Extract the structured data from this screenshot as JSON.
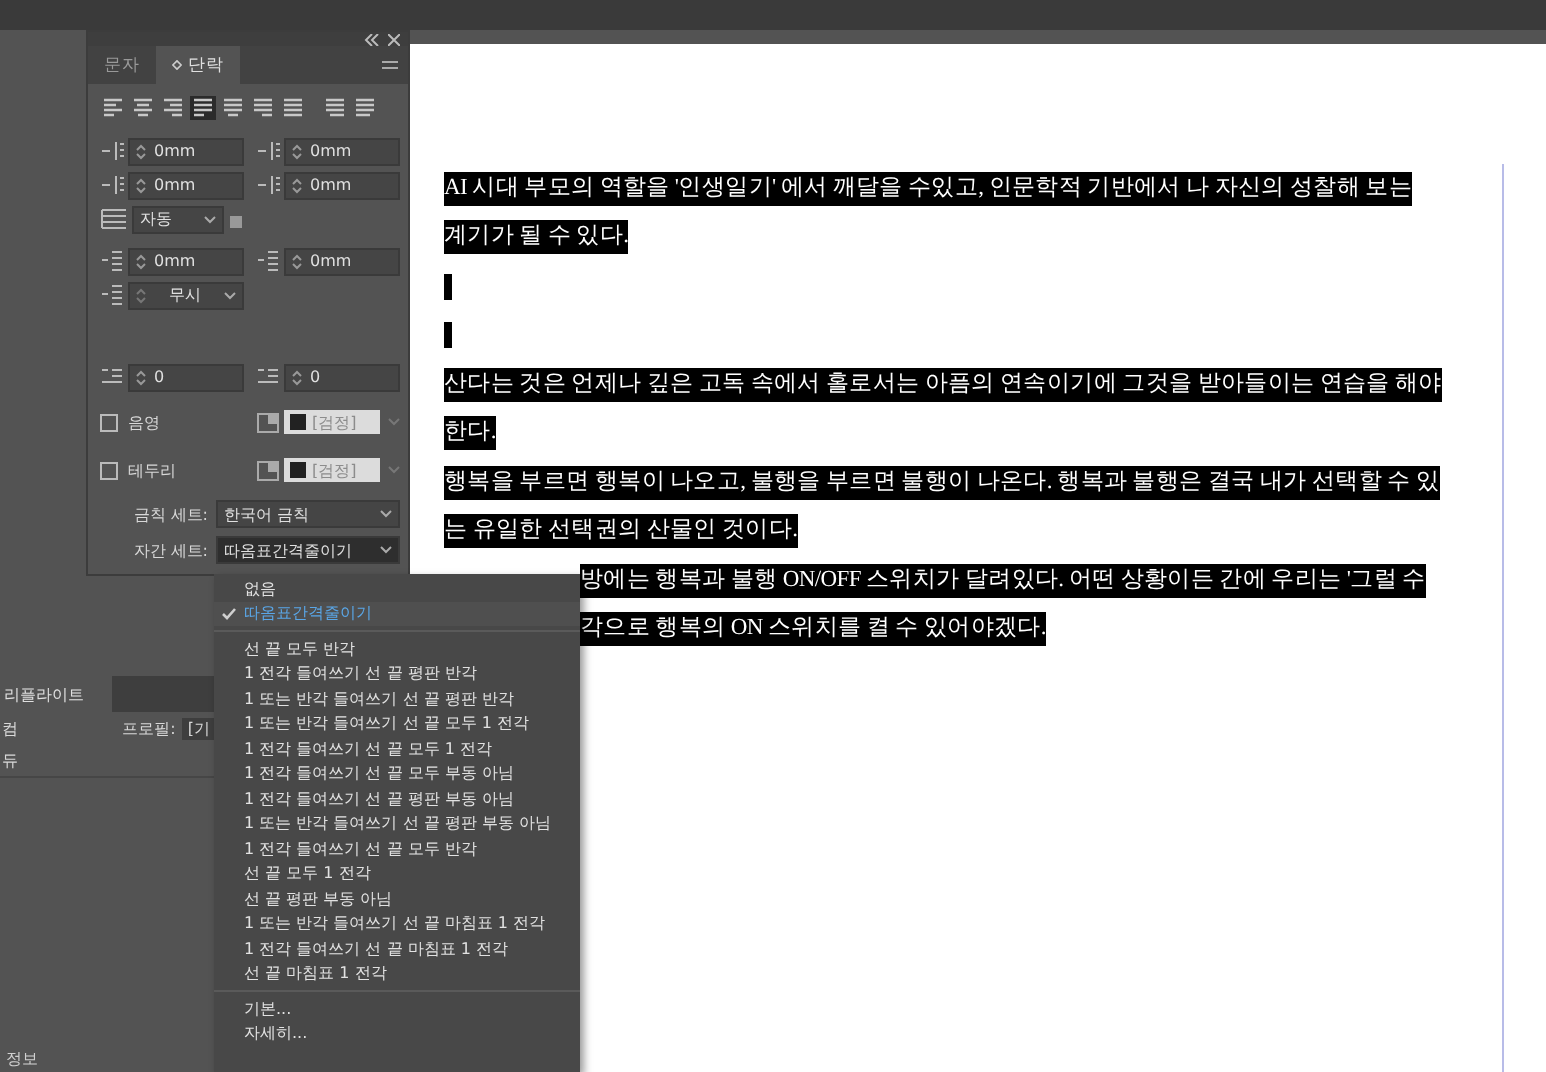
{
  "panel": {
    "tabs": [
      {
        "label": "문자",
        "selected": false
      },
      {
        "label": "단락",
        "selected": true
      }
    ],
    "alignment": [
      {
        "selected": false
      },
      {
        "selected": false
      },
      {
        "selected": false
      },
      {
        "selected": true
      },
      {
        "selected": false
      },
      {
        "selected": false
      },
      {
        "selected": false
      },
      {
        "selected": false
      },
      {
        "selected": false
      }
    ],
    "indent_fields": [
      {
        "value": "0mm"
      },
      {
        "value": "0mm"
      },
      {
        "value": "0mm"
      },
      {
        "value": "0mm"
      }
    ],
    "drop_lines": {
      "value": "자동"
    },
    "space_fields": [
      {
        "value": "0mm"
      },
      {
        "value": "0mm"
      }
    ],
    "grid_align": {
      "value": "무시"
    },
    "drop_fields": [
      {
        "value": "0"
      },
      {
        "value": "0"
      }
    ],
    "options": [
      {
        "label": "음영",
        "checked": false,
        "swatch": "[검정]"
      },
      {
        "label": "테두리",
        "checked": false,
        "swatch": "[검정]"
      }
    ],
    "sets": [
      {
        "label": "금칙 세트:",
        "value": "한국어 금칙"
      },
      {
        "label": "자간 세트:",
        "value": "따옴표간격줄이기"
      }
    ]
  },
  "document": {
    "lines": [
      {
        "kind": "text",
        "text": "AI 시대 부모의 역할을 '인생일기' 에서 깨달을 수있고, 인문학적 기반에서 나 자신의 성찰해 보는"
      },
      {
        "kind": "text",
        "text": "계기가 될 수 있다."
      },
      {
        "kind": "caret"
      },
      {
        "kind": "caret"
      },
      {
        "kind": "text",
        "text": "산다는 것은 언제나 깊은 고독 속에서 홀로서는 아픔의 연속이기에 그것을 받아들이는 연습을 해야"
      },
      {
        "kind": "text",
        "text": "한다."
      },
      {
        "kind": "text",
        "text": " 행복을 부르면 행복이 나오고, 불행을 부르면 불행이 나온다. 행복과 불행은 결국 내가 선택할 수 있"
      },
      {
        "kind": "text",
        "text": "는 유일한 선택권의 산물인 것이다."
      },
      {
        "kind": "partial",
        "text": "방에는 행복과 불행 ON/OFF 스위치가 달려있다. 어떤 상황이든 간에 우리는 '그럴 수"
      },
      {
        "kind": "partial",
        "text": "각으로 행복의 ON 스위치를 켤 수 있어야겠다."
      }
    ]
  },
  "menu": {
    "items": [
      {
        "kind": "item",
        "label": "없음",
        "selected": false
      },
      {
        "kind": "item",
        "label": "따옴표간격줄이기",
        "selected": true
      },
      {
        "kind": "separator"
      },
      {
        "kind": "item",
        "label": "선 끝 모두 반각",
        "selected": false
      },
      {
        "kind": "item",
        "label": "1 전각 들여쓰기 선 끝 평판 반각",
        "selected": false
      },
      {
        "kind": "item",
        "label": "1 또는 반각 들여쓰기 선 끝 평판 반각",
        "selected": false
      },
      {
        "kind": "item",
        "label": "1 또는 반각 들여쓰기 선 끝 모두 1 전각",
        "selected": false
      },
      {
        "kind": "item",
        "label": "1 전각 들여쓰기 선 끝 모두 1 전각",
        "selected": false
      },
      {
        "kind": "item",
        "label": "1 전각 들여쓰기 선 끝 모두 부동 아님",
        "selected": false
      },
      {
        "kind": "item",
        "label": "1 전각 들여쓰기 선 끝 평판 부동 아님",
        "selected": false
      },
      {
        "kind": "item",
        "label": "1 또는 반각 들여쓰기 선 끝 평판 부동 아님",
        "selected": false
      },
      {
        "kind": "item",
        "label": "1 전각 들여쓰기 선 끝 모두 반각",
        "selected": false
      },
      {
        "kind": "item",
        "label": "선 끝 모두 1 전각",
        "selected": false
      },
      {
        "kind": "item",
        "label": "선 끝 평판 부동 아님",
        "selected": false
      },
      {
        "kind": "item",
        "label": "1 또는 반각 들여쓰기 선 끝 마침표 1 전각",
        "selected": false
      },
      {
        "kind": "item",
        "label": "1 전각 들여쓰기 선 끝 마침표 1 전각",
        "selected": false
      },
      {
        "kind": "item",
        "label": "선 끝 마침표 1 전각",
        "selected": false
      },
      {
        "kind": "separator"
      },
      {
        "kind": "item",
        "label": "기본...",
        "selected": false
      },
      {
        "kind": "item",
        "label": "자세히...",
        "selected": false
      }
    ]
  },
  "preflight": {
    "tab": "리플라이트",
    "row_1": "컴",
    "profile_label": "프로필:",
    "profile_value": "[기",
    "row_2": "듀",
    "footer": "정보"
  }
}
